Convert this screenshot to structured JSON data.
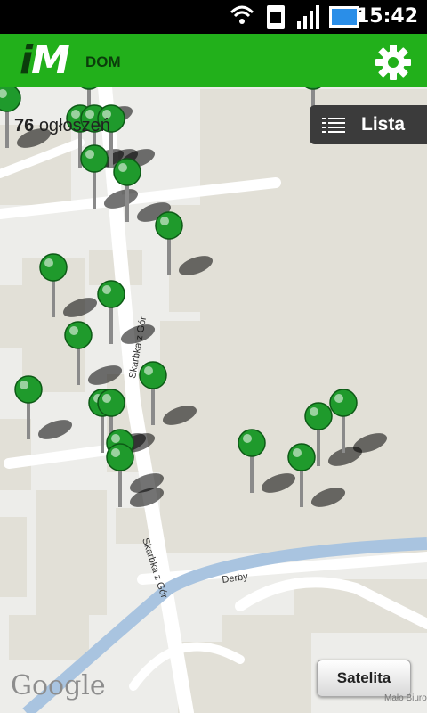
{
  "status_bar": {
    "time": "15:42"
  },
  "app": {
    "logo_i": "i",
    "logo_m": "M",
    "section": "DOM"
  },
  "header": {
    "count": "76",
    "count_label": "ogłoszeń"
  },
  "buttons": {
    "list_label": "Lista",
    "satellite_label": "Satelita"
  },
  "map": {
    "streets": [
      "Skarbka z Gór",
      "Skarbka z Gór",
      "Derby"
    ],
    "attribution": "Google",
    "copyright": "Mało Biuro",
    "pin_color": "#1f9a2c",
    "pin_count_visible": 26
  },
  "colors": {
    "accent": "#22b01b",
    "map_bg": "#ededea",
    "river": "#a9c4e0"
  }
}
